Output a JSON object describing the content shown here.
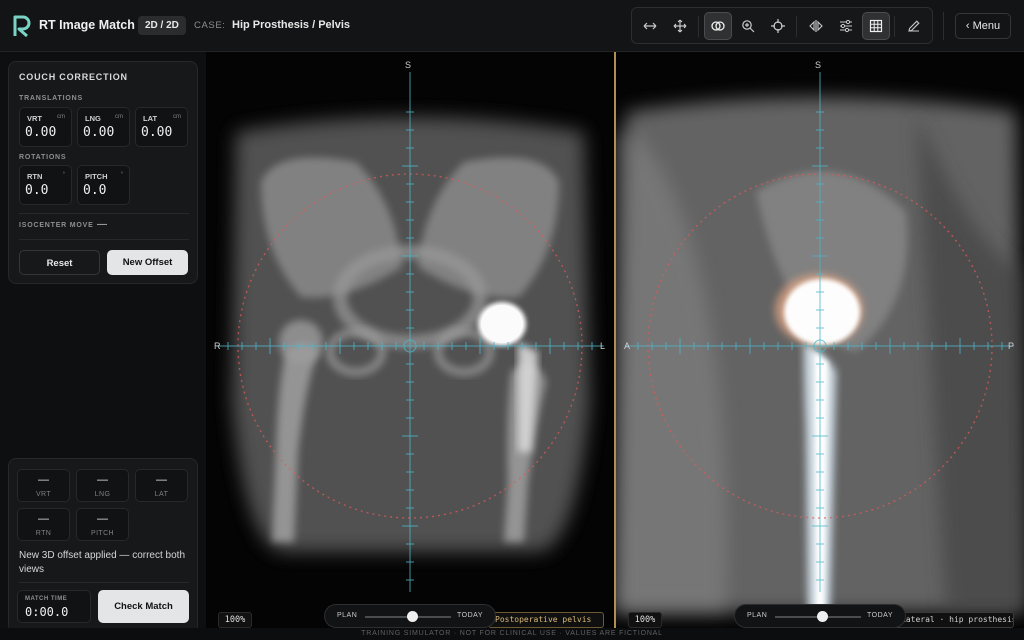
{
  "app": {
    "title": "RT Image Match",
    "mode": "2D / 2D",
    "case_label": "CASE:",
    "case_value": "Hip Prosthesis / Pelvis"
  },
  "toolbar": {
    "tools": [
      {
        "name": "pan-horizontal-icon",
        "active": false
      },
      {
        "name": "move-icon",
        "active": false
      },
      {
        "name": "overlay-icon",
        "active": true
      },
      {
        "name": "zoom-icon",
        "active": false
      },
      {
        "name": "crosshair-icon",
        "active": false
      },
      {
        "name": "mirror-icon",
        "active": false
      },
      {
        "name": "adjust-icon",
        "active": false
      },
      {
        "name": "grid-icon",
        "active": true
      },
      {
        "name": "pencil-icon",
        "active": false
      }
    ]
  },
  "menu": {
    "label": "‹ Menu"
  },
  "couch": {
    "title": "COUCH CORRECTION",
    "translations_label": "TRANSLATIONS",
    "rotations_label": "ROTATIONS",
    "translations": [
      {
        "name": "VRT",
        "unit": "cm",
        "value": "0.00"
      },
      {
        "name": "LNG",
        "unit": "cm",
        "value": "0.00"
      },
      {
        "name": "LAT",
        "unit": "cm",
        "value": "0.00"
      }
    ],
    "rotations": [
      {
        "name": "RTN",
        "unit": "°",
        "value": "0.0"
      },
      {
        "name": "PITCH",
        "unit": "°",
        "value": "0.0"
      }
    ],
    "isocenter_label": "ISOCENTER MOVE",
    "isocenter_value": "—",
    "reset_label": "Reset",
    "new_offset_label": "New Offset"
  },
  "result": {
    "cells": [
      {
        "name": "VRT",
        "value": "—"
      },
      {
        "name": "LNG",
        "value": "—"
      },
      {
        "name": "LAT",
        "value": "—"
      },
      {
        "name": "RTN",
        "value": "—"
      },
      {
        "name": "PITCH",
        "value": "—"
      }
    ],
    "message": "New 3D offset applied — correct both views",
    "match_time_label": "MATCH TIME",
    "match_time_value": "0:00.0",
    "check_label": "Check Match"
  },
  "views": {
    "left": {
      "top": "S",
      "left_edge": "R",
      "right_edge": "L",
      "zoom": "100%",
      "caption": "Postoperative pelvis",
      "blend_plan": "PLAN",
      "blend_today": "TODAY",
      "blend": 0.55
    },
    "right": {
      "top": "S",
      "left_edge": "A",
      "right_edge": "P",
      "zoom": "100%",
      "caption": "Lateral · hip prosthesis",
      "blend_plan": "PLAN",
      "blend_today": "TODAY",
      "blend": 0.55
    }
  },
  "footer": "TRAINING SIMULATOR · NOT FOR CLINICAL USE · VALUES ARE FICTIONAL",
  "colors": {
    "accent_cyan": "#4fb7c9",
    "target_ring": "#e05a5a",
    "divider_gold": "#b38d56"
  }
}
